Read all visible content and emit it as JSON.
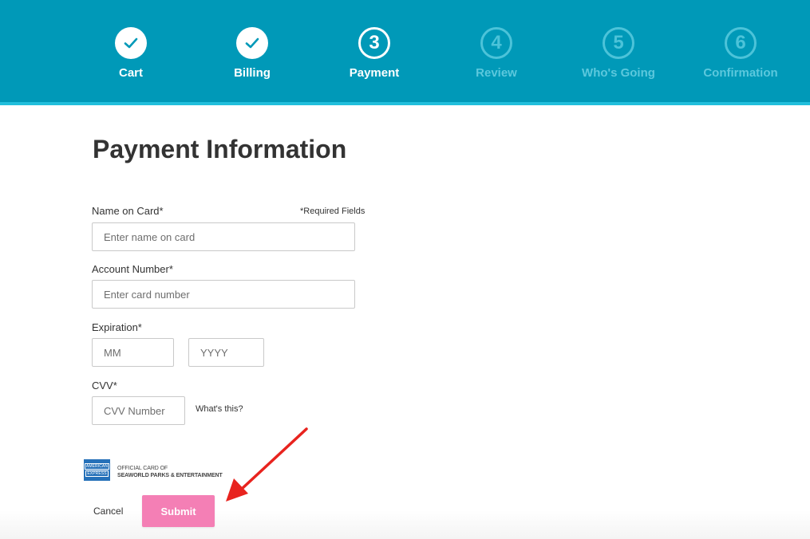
{
  "steps": [
    {
      "number": "1",
      "label": "Cart",
      "state": "done"
    },
    {
      "number": "2",
      "label": "Billing",
      "state": "done"
    },
    {
      "number": "3",
      "label": "Payment",
      "state": "current"
    },
    {
      "number": "4",
      "label": "Review",
      "state": "upcoming"
    },
    {
      "number": "5",
      "label": "Who's Going",
      "state": "upcoming"
    },
    {
      "number": "6",
      "label": "Confirmation",
      "state": "upcoming"
    }
  ],
  "page": {
    "title": "Payment Information",
    "required_note": "*Required Fields"
  },
  "form": {
    "name_label": "Name on Card*",
    "name_placeholder": "Enter name on card",
    "account_label": "Account Number*",
    "account_placeholder": "Enter card number",
    "expiration_label": "Expiration*",
    "month_placeholder": "MM",
    "year_placeholder": "YYYY",
    "cvv_label": "CVV*",
    "cvv_placeholder": "CVV Number",
    "whats_this": "What's this?"
  },
  "sponsor": {
    "amex_line1": "AMERICAN",
    "amex_line2": "EXPRESS",
    "line1": "OFFICIAL CARD OF",
    "line2": "SEAWORLD PARKS & ENTERTAINMENT"
  },
  "actions": {
    "cancel": "Cancel",
    "submit": "Submit"
  },
  "colors": {
    "header_bg": "#0099b8",
    "header_accent": "#22bfdc",
    "submit_bg": "#f47fb5",
    "annotation_arrow": "#e8231e"
  }
}
